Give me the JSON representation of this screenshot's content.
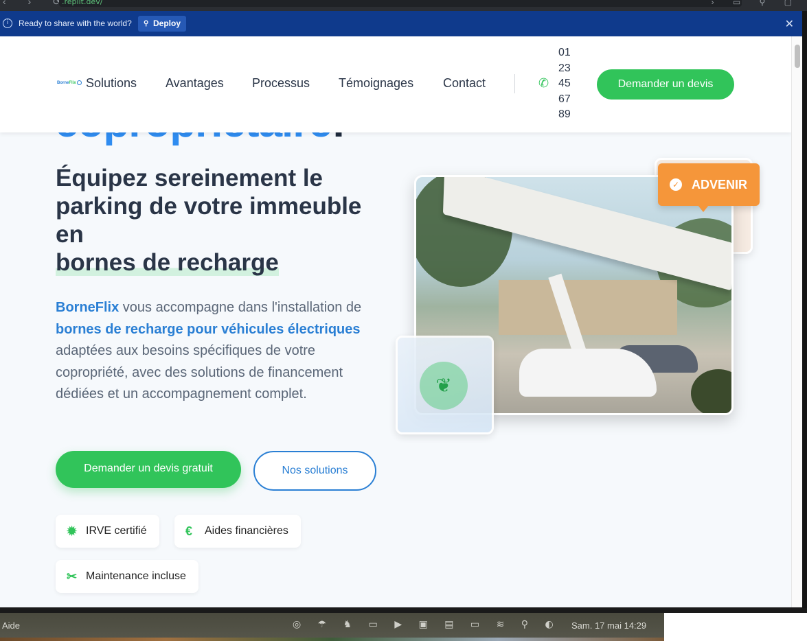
{
  "browser": {
    "url": ".replit.dev/",
    "nav_icons": "‹ › ⟳",
    "right_icons": "› ▭ ⚲ ▢"
  },
  "banner": {
    "message": "Ready to share with the world?",
    "deploy_label": "Deploy",
    "info_icon": "i",
    "rocket_icon": "⚲",
    "close_icon": "✕"
  },
  "header": {
    "logo": {
      "borne": "Borne",
      "flix": "Flix"
    },
    "nav": [
      "Solutions",
      "Avantages",
      "Processus",
      "Témoignages",
      "Contact"
    ],
    "phone": "01 23 45 67 89",
    "phone_icon": "✆",
    "cta": "Demander un devis"
  },
  "hero": {
    "title": "copropriétaire",
    "title_end": "!",
    "subtitle_plain": "Équipez sereinement le parking de votre immeuble en",
    "subtitle_highlight": "bornes de recharge",
    "lead": {
      "brand": "BorneFlix",
      "p1": " vous accompagne dans l'installation de ",
      "brand2": "bornes de recharge pour véhicules électriques",
      "p2": " adaptées aux besoins spécifiques de votre copropriété, avec des solutions de financement dédiées et un accompagnement complet."
    },
    "primary_button": "Demander un devis gratuit",
    "secondary_button": "Nos solutions",
    "badges": [
      {
        "icon": "✹",
        "label": "IRVE certifié"
      },
      {
        "icon": "€",
        "label": "Aides financières"
      },
      {
        "icon": "✂",
        "label": "Maintenance incluse"
      }
    ],
    "advenir_label": "ADVENIR",
    "advenir_check": "✓",
    "leaf_icon": "❦"
  },
  "menubar": {
    "app_menu": "Aide",
    "status_icons": "◎ ☂ ♞ ▭ ▶ ▣ ▤ ▭ ≋ ⚲ ◐",
    "clock": "Sam. 17 mai  14:29"
  },
  "colors": {
    "accent_blue": "#2a7fd4",
    "accent_green": "#31c45a",
    "banner_blue": "#0f3a8c",
    "advenir_orange": "#f5963a"
  }
}
